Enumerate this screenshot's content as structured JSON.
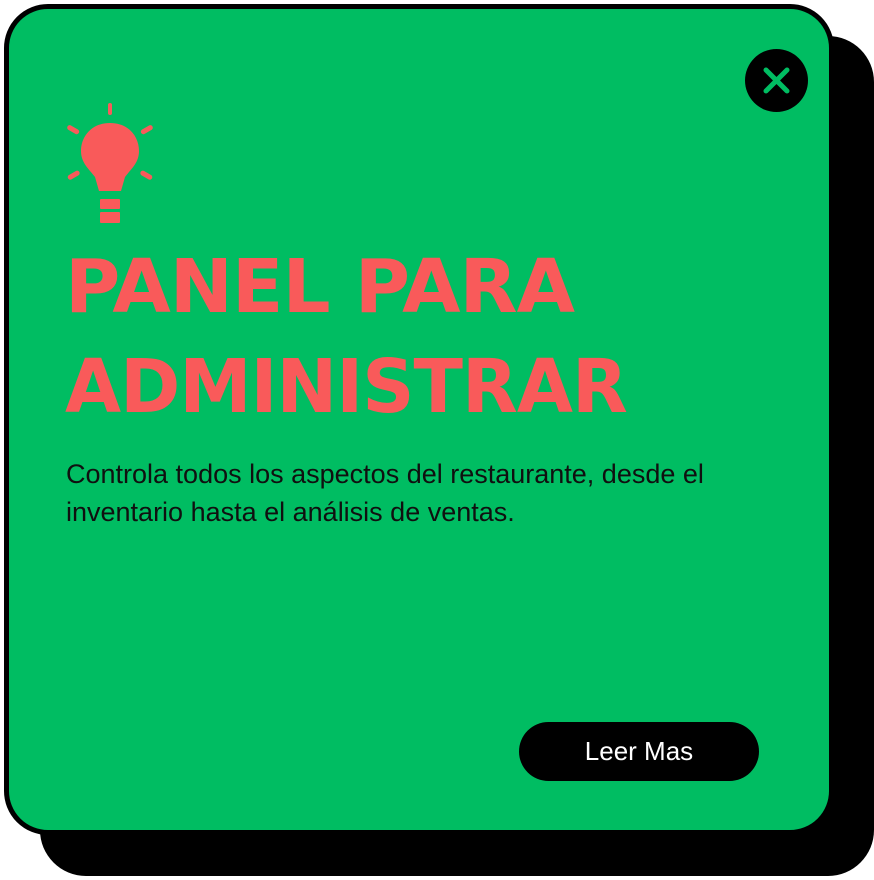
{
  "popup": {
    "title_line1": "PANEL PARA",
    "title_line2": "ADMINISTRAR",
    "description": "Controla todos los aspectos del restaurante, desde el inventario hasta el análisis de ventas.",
    "cta_label": "Leer Mas",
    "icons": {
      "close": "close-icon",
      "bulb": "lightbulb-icon"
    }
  },
  "colors": {
    "background": "#00bd62",
    "accent": "#f95a5a",
    "dark": "#000000",
    "button_text": "#ffffff"
  }
}
